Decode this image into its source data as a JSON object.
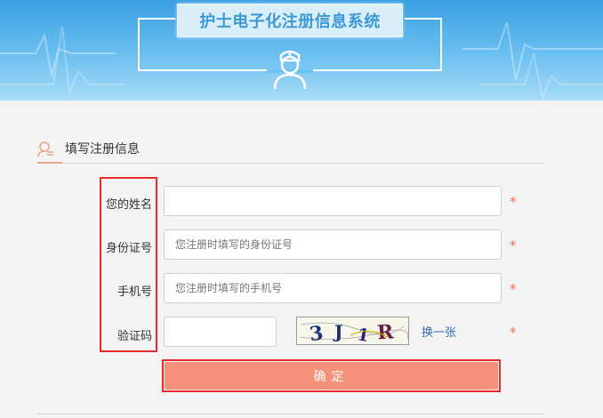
{
  "header": {
    "title": "护士电子化注册信息系统"
  },
  "section": {
    "title": "填写注册信息"
  },
  "form": {
    "name_label": "您的姓名",
    "name_value": "",
    "id_label": "身份证号",
    "id_placeholder": "您注册时填写的身份证号",
    "phone_label": "手机号",
    "phone_placeholder": "您注册时填写的手机号",
    "captcha_label": "验证码",
    "captcha_value": "",
    "captcha_text": "3J1R",
    "change_captcha": "换一张",
    "required_mark": "*",
    "submit_label": "确定"
  },
  "colors": {
    "accent": "#f5907a",
    "required": "#f26b5b",
    "link": "#2e6fb0",
    "highlight_frame": "#e52b2b"
  }
}
